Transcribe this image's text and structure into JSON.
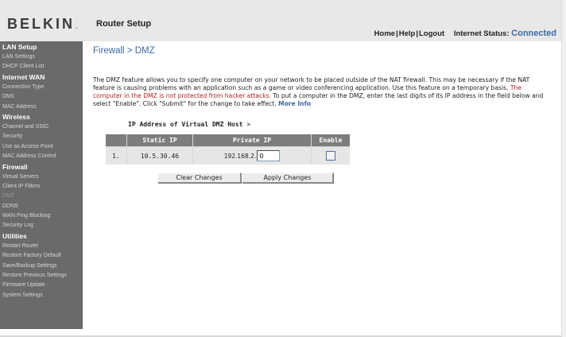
{
  "header": {
    "logo": "BELKIN",
    "logo_mark": ".",
    "title": "Router Setup",
    "nav": {
      "home": "Home",
      "help": "Help",
      "logout": "Logout",
      "sep": "|"
    },
    "status_label": "Internet Status:",
    "status_value": "Connected"
  },
  "sidebar": {
    "sections": [
      {
        "label": "LAN Setup",
        "items": [
          {
            "label": "LAN Settings"
          },
          {
            "label": "DHCP Client List"
          }
        ]
      },
      {
        "label": "Internet WAN",
        "items": [
          {
            "label": "Connection Type"
          },
          {
            "label": "DNS"
          },
          {
            "label": "MAC Address"
          }
        ]
      },
      {
        "label": "Wireless",
        "items": [
          {
            "label": "Channel and SSID"
          },
          {
            "label": "Security"
          },
          {
            "label": "Use as Access Point"
          },
          {
            "label": "MAC Address Control"
          }
        ]
      },
      {
        "label": "Firewall",
        "items": [
          {
            "label": "Virtual Servers"
          },
          {
            "label": "Client IP Filters"
          },
          {
            "label": "DMZ"
          },
          {
            "label": "DDNS"
          },
          {
            "label": "WAN Ping Blocking"
          },
          {
            "label": "Security Log"
          }
        ]
      },
      {
        "label": "Utilities",
        "items": [
          {
            "label": "Restart Router"
          },
          {
            "label": "Restore Factory Default"
          },
          {
            "label": "Save/Backup Settings"
          },
          {
            "label": "Restore Previous Settings"
          },
          {
            "label": "Firmware Update"
          },
          {
            "label": "System Settings"
          }
        ]
      }
    ]
  },
  "main": {
    "title": "Firewall > DMZ",
    "description": {
      "text1": "The DMZ feature allows you to specify one computer on your network to be placed outside of the NAT firewall. This may be necessary if the NAT feature is causing problems with an application such as a game or video conferencing application. Use this feature on a temporary basis. ",
      "warning": "The computer in the DMZ is not protected from hacker attacks.",
      "text2": " To put a computer in the DMZ, enter the last digits of its IP address in the field below and select \"Enable\". Click \"Submit\" for the change to take effect. ",
      "more_info": "More Info"
    },
    "dmz_label": "IP Address of Virtual DMZ Host",
    "dmz_label_suffix": " >",
    "table": {
      "headers": {
        "static_ip": "Static IP",
        "private_ip": "Private IP",
        "enable": "Enable"
      },
      "row": {
        "index": "1.",
        "static_ip": "10.5.30.46",
        "private_ip_prefix": "192.168.2.",
        "private_ip_last": "0",
        "enabled": false
      }
    },
    "buttons": {
      "clear": "Clear Changes",
      "apply": "Apply Changes"
    }
  },
  "colors": {
    "sidebar_bg": "#6a6a6a",
    "header_bg": "#e8e8e8",
    "accent_blue": "#3d6aa6",
    "warning_red": "#b22222",
    "table_header_bg": "#7d7d7d"
  }
}
